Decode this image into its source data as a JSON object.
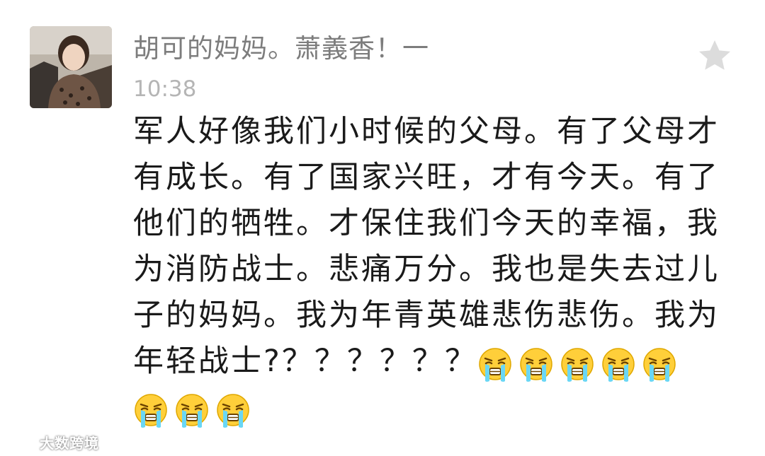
{
  "comment": {
    "author": "胡可的妈妈。萧義香！一",
    "time": "10:38",
    "content_lines": [
      "军人好像我们小时候的父母。有了父母才",
      "有成长。有了国家兴旺，才有今天。有了",
      "他们的牺牲。才保住我们今天的幸福，我",
      "为消防战士。悲痛万分。我也是失去过儿",
      "子的妈妈。我为年青英雄悲伤悲伤。我为",
      "年轻战士?？？？？？？"
    ],
    "emoji_name": "crying-face-emoji",
    "emoji_count_line6": 5,
    "emoji_count_line7": 3,
    "star_icon": "star-icon"
  },
  "watermark": {
    "text": "大数跨境"
  }
}
